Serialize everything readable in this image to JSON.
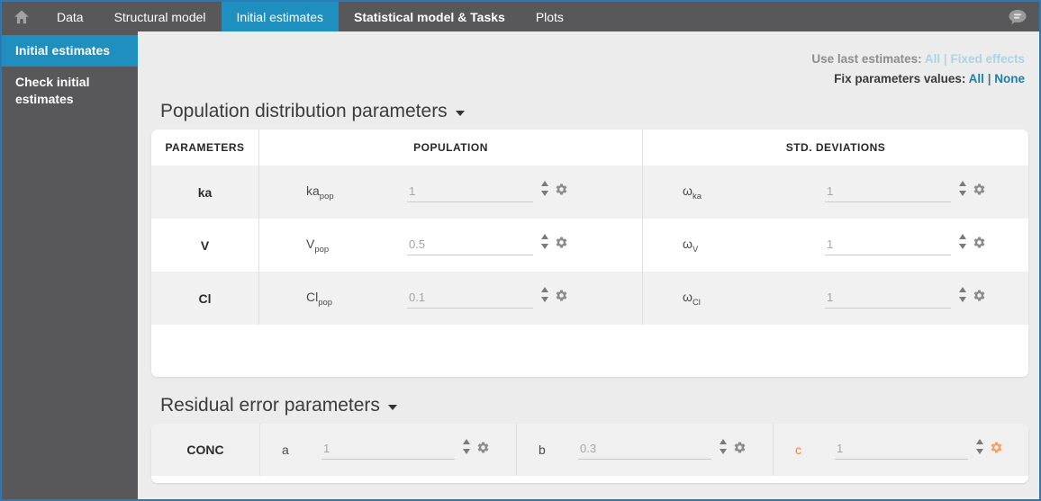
{
  "window": {
    "border_color": "#2a79b5"
  },
  "topnav": {
    "tabs": [
      {
        "label": "Data",
        "active": false,
        "bold": false
      },
      {
        "label": "Structural model",
        "active": false,
        "bold": false
      },
      {
        "label": "Initial estimates",
        "active": true,
        "bold": false
      },
      {
        "label": "Statistical model & Tasks",
        "active": false,
        "bold": true
      },
      {
        "label": "Plots",
        "active": false,
        "bold": false
      }
    ],
    "icons": {
      "home": "home-icon",
      "chat": "chat-bubble-icon"
    }
  },
  "sidebar": {
    "items": [
      {
        "label": "Initial estimates",
        "active": true
      },
      {
        "label": "Check initial estimates",
        "active": false
      }
    ]
  },
  "actions": {
    "use_last_label": "Use last estimates:",
    "use_last_all": "All",
    "use_last_fixed": "Fixed effects",
    "fix_label": "Fix parameters values:",
    "fix_all": "All",
    "fix_none": "None",
    "separator": "|"
  },
  "population_section": {
    "title": "Population distribution parameters",
    "columns": [
      "PARAMETERS",
      "POPULATION",
      "STD. DEVIATIONS"
    ],
    "rows": [
      {
        "param": "ka",
        "pop_base": "ka",
        "pop_sub": "pop",
        "pop_value": "1",
        "sd_base": "ω",
        "sd_sub": "ka",
        "sd_value": "1"
      },
      {
        "param": "V",
        "pop_base": "V",
        "pop_sub": "pop",
        "pop_value": "0.5",
        "sd_base": "ω",
        "sd_sub": "V",
        "sd_value": "1"
      },
      {
        "param": "Cl",
        "pop_base": "Cl",
        "pop_sub": "pop",
        "pop_value": "0.1",
        "sd_base": "ω",
        "sd_sub": "Cl",
        "sd_value": "1"
      }
    ]
  },
  "residual_section": {
    "title": "Residual error parameters",
    "row_label": "CONC",
    "params": [
      {
        "label": "a",
        "value": "1",
        "highlight": false
      },
      {
        "label": "b",
        "value": "0.3",
        "highlight": false
      },
      {
        "label": "c",
        "value": "1",
        "highlight": true
      }
    ]
  },
  "colors": {
    "nav_background": "#58585a",
    "active_tab_blue": "#1f8fbf",
    "link_blue": "#1d7fae",
    "link_blue_disabled": "#a9d4e6",
    "highlight_orange": "#ef9a68",
    "row_stripe": "#f1f1f1",
    "window_border": "#2a79b5"
  }
}
